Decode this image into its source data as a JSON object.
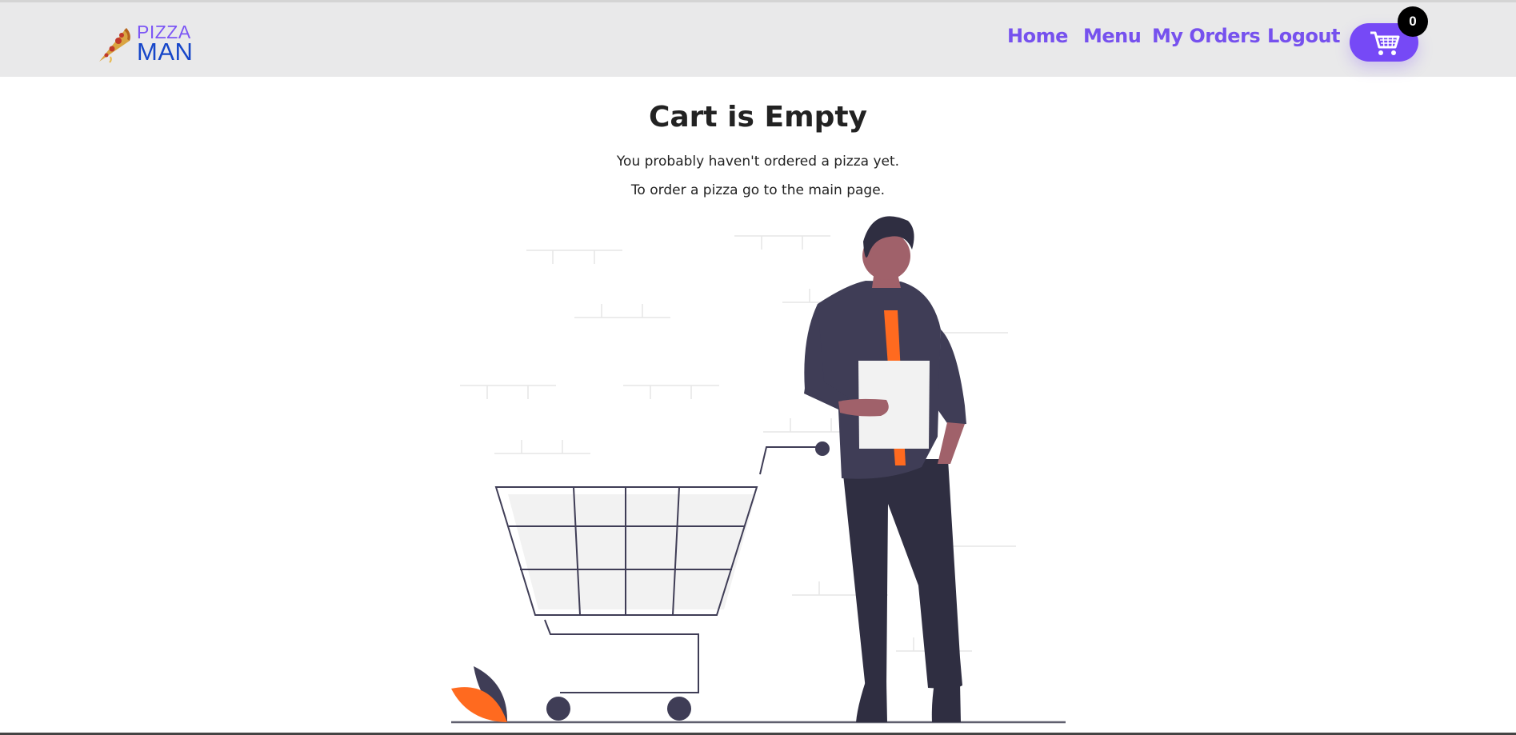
{
  "brand": {
    "line1": "PIZZA",
    "line2": "MAN"
  },
  "nav": {
    "home": "Home",
    "menu": "Menu",
    "orders": "My Orders",
    "logout": "Logout"
  },
  "cart": {
    "count": "0",
    "icon": "cart-icon"
  },
  "empty_state": {
    "title": "Cart is Empty",
    "line1": "You probably haven't ordered a pizza yet.",
    "line2": "To order a pizza go to the main page."
  },
  "colors": {
    "accent": "#7651ee",
    "cart_button": "#7649f6",
    "navbar_bg": "#e9e9ea",
    "illustration_dark": "#3f3d56",
    "illustration_orange": "#ff6a1f"
  }
}
